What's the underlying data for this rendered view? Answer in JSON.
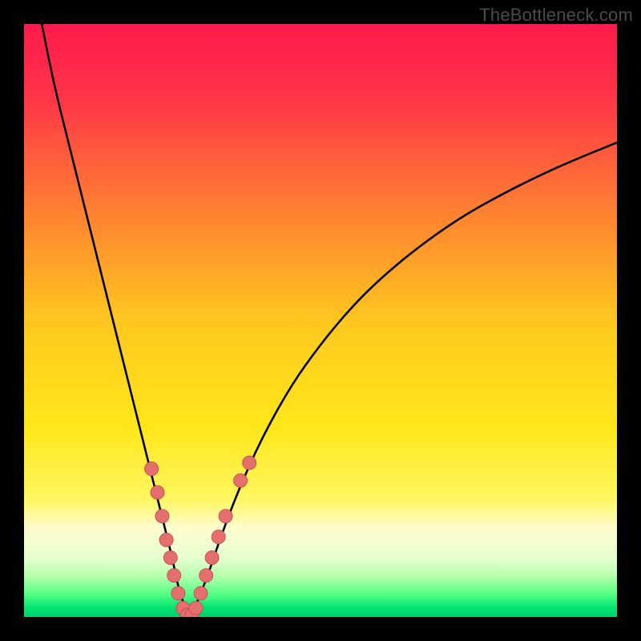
{
  "watermark": "TheBottleneck.com",
  "colors": {
    "frame": "#000000",
    "gradient_stops": [
      {
        "offset": 0.0,
        "color": "#ff1a4d"
      },
      {
        "offset": 0.12,
        "color": "#ff3348"
      },
      {
        "offset": 0.3,
        "color": "#ff7a33"
      },
      {
        "offset": 0.5,
        "color": "#ffc71f"
      },
      {
        "offset": 0.68,
        "color": "#ffe71a"
      },
      {
        "offset": 0.8,
        "color": "#fff65f"
      },
      {
        "offset": 0.85,
        "color": "#fffccf"
      },
      {
        "offset": 0.9,
        "color": "#e5ffcf"
      },
      {
        "offset": 0.93,
        "color": "#b8ffb0"
      },
      {
        "offset": 0.96,
        "color": "#5bff86"
      },
      {
        "offset": 0.985,
        "color": "#00e472"
      },
      {
        "offset": 1.0,
        "color": "#00cf6a"
      }
    ],
    "curve": "#000000",
    "dots_fill": "#e46f6f",
    "dots_stroke": "#c94b4b"
  },
  "chart_data": {
    "type": "line",
    "title": "",
    "xlabel": "",
    "ylabel": "",
    "xlim": [
      0,
      100
    ],
    "ylim": [
      0,
      100
    ],
    "series": [
      {
        "name": "bottleneck-curve",
        "x": [
          3,
          5,
          8,
          11,
          14,
          17,
          19,
          21,
          23,
          25,
          26,
          27,
          28,
          29,
          31,
          33,
          36,
          40,
          45,
          50,
          55,
          60,
          66,
          73,
          80,
          88,
          95,
          100
        ],
        "y": [
          100,
          90,
          78,
          66,
          54,
          42,
          34,
          26,
          18,
          10,
          5,
          2,
          0,
          2,
          7,
          13,
          21,
          30,
          39,
          46,
          52,
          57,
          62,
          67,
          71,
          75,
          78,
          80
        ]
      }
    ],
    "scatter": {
      "name": "highlighted-points",
      "points": [
        {
          "x": 21.5,
          "y": 25
        },
        {
          "x": 22.5,
          "y": 21
        },
        {
          "x": 23.3,
          "y": 17
        },
        {
          "x": 24.0,
          "y": 13
        },
        {
          "x": 24.7,
          "y": 10
        },
        {
          "x": 25.3,
          "y": 7
        },
        {
          "x": 26.0,
          "y": 4
        },
        {
          "x": 26.8,
          "y": 1.5
        },
        {
          "x": 27.5,
          "y": 0.3
        },
        {
          "x": 28.3,
          "y": 0.3
        },
        {
          "x": 29.0,
          "y": 1.5
        },
        {
          "x": 29.8,
          "y": 4
        },
        {
          "x": 30.7,
          "y": 7
        },
        {
          "x": 31.7,
          "y": 10
        },
        {
          "x": 32.8,
          "y": 13.5
        },
        {
          "x": 34.0,
          "y": 17
        },
        {
          "x": 36.5,
          "y": 23
        },
        {
          "x": 38.0,
          "y": 26
        }
      ]
    }
  }
}
